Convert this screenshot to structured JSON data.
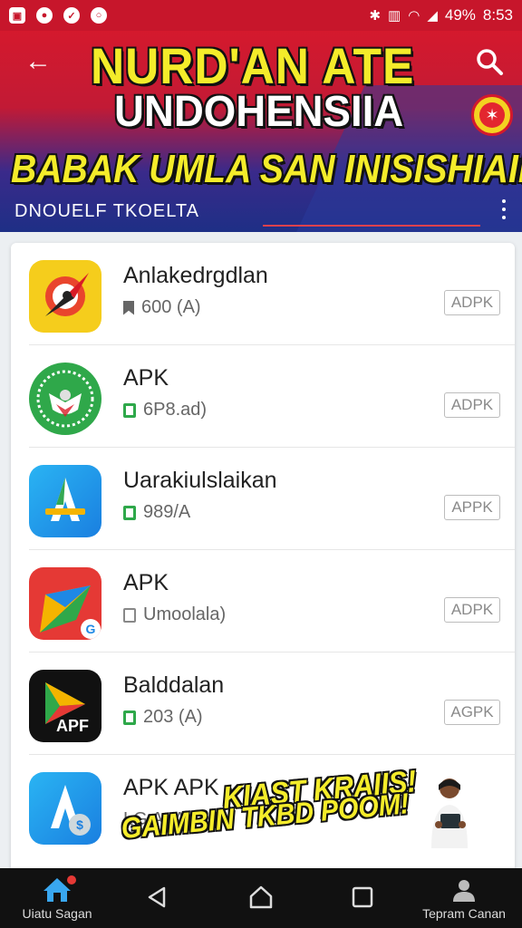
{
  "status_bar": {
    "battery": "49%",
    "time": "8:53"
  },
  "header": {
    "title_line1": "NURD'AN ATE",
    "title_line2": "UNDOHENSIIA",
    "subtitle": "BABAK UMLA SAN INISISHIAINARCA,",
    "caption": "DNOUELF TKOELTA"
  },
  "apps": [
    {
      "name": "Anlakedrgdlan",
      "meta": "600 (A)",
      "badge": "ADPK"
    },
    {
      "name": "APK",
      "meta": "6P8.ad)",
      "badge": "ADPK"
    },
    {
      "name": "Uarakiulslaikan",
      "meta": "989/A",
      "badge": "APPK"
    },
    {
      "name": "APK",
      "meta": "Umoolala)",
      "badge": "ADPK"
    },
    {
      "name": "Balddalan",
      "meta": "203 (A)",
      "badge": "AGPK"
    },
    {
      "name": "APK APK",
      "meta": "LG AoA)",
      "badge": ""
    }
  ],
  "app_icon_label": "APF",
  "promo": {
    "line1": "KIAST KRAIIS!",
    "line2": "GAIMBIN TKBD POOM!"
  },
  "bottom_nav": {
    "home_label": "Uiatu Sagan",
    "profile_label": "Tepram Canan"
  },
  "colors": {
    "accent_red": "#c7162b",
    "title_yellow": "#f4ec2a",
    "header_blue": "#1e2f86"
  }
}
